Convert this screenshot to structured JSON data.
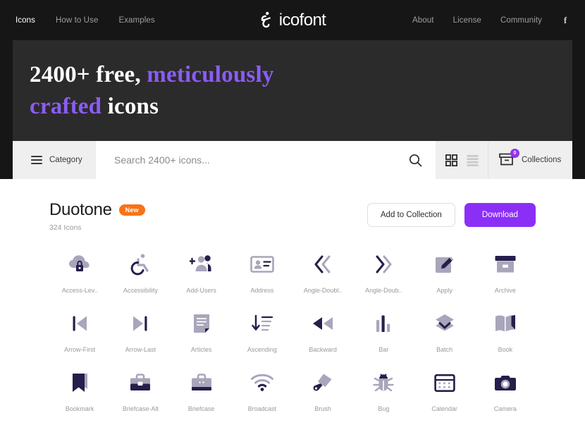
{
  "nav": {
    "left_links": [
      {
        "label": "Icons",
        "active": true
      },
      {
        "label": "How to Use",
        "active": false
      },
      {
        "label": "Examples",
        "active": false
      }
    ],
    "right_links": [
      {
        "label": "About"
      },
      {
        "label": "License"
      },
      {
        "label": "Community"
      }
    ],
    "social_icon": "facebook-icon",
    "logo_text": "icofont"
  },
  "hero": {
    "line1_part1": "2400+ free, ",
    "line1_accent": "meticulously",
    "line2_accent": "crafted",
    "line2_part2": " icons"
  },
  "search": {
    "category_label": "Category",
    "placeholder": "Search 2400+ icons...",
    "value": "",
    "search_icon": "search-icon",
    "grid_view_icon": "grid-view-icon",
    "list_view_icon": "list-view-icon",
    "active_view": "grid",
    "collections_label": "Collections",
    "collections_count": "0"
  },
  "section": {
    "title": "Duotone",
    "badge": "New",
    "count": "324 Icons",
    "add_button": "Add to Collection",
    "download_button": "Download"
  },
  "colors": {
    "accent_purple": "#8b2ff7",
    "hero_accent": "#8b5cf6",
    "badge_orange": "#f97316",
    "icon_dark": "#241f4b",
    "icon_light": "#a9a5bb",
    "header_bg": "#161616",
    "hero_bg": "#2b2b2b"
  },
  "icons": [
    {
      "name": "Access-Lev..",
      "key": "access-level"
    },
    {
      "name": "Accessibility",
      "key": "accessibility"
    },
    {
      "name": "Add-Users",
      "key": "add-users"
    },
    {
      "name": "Address",
      "key": "address"
    },
    {
      "name": "Angle-Doubl..",
      "key": "angle-double-left"
    },
    {
      "name": "Angle-Doub..",
      "key": "angle-double-right"
    },
    {
      "name": "Apply",
      "key": "apply"
    },
    {
      "name": "Archive",
      "key": "archive"
    },
    {
      "name": "Arrow-First",
      "key": "arrow-first"
    },
    {
      "name": "Arrow-Last",
      "key": "arrow-last"
    },
    {
      "name": "Articles",
      "key": "articles"
    },
    {
      "name": "Ascending",
      "key": "ascending"
    },
    {
      "name": "Backward",
      "key": "backward"
    },
    {
      "name": "Bar",
      "key": "bar"
    },
    {
      "name": "Batch",
      "key": "batch"
    },
    {
      "name": "Book",
      "key": "book"
    },
    {
      "name": "Bookmark",
      "key": "bookmark"
    },
    {
      "name": "Briefcase-Alt",
      "key": "briefcase-alt"
    },
    {
      "name": "Briefcase",
      "key": "briefcase"
    },
    {
      "name": "Broadcast",
      "key": "broadcast"
    },
    {
      "name": "Brush",
      "key": "brush"
    },
    {
      "name": "Bug",
      "key": "bug"
    },
    {
      "name": "Calendar",
      "key": "calendar"
    },
    {
      "name": "Camera",
      "key": "camera"
    }
  ]
}
